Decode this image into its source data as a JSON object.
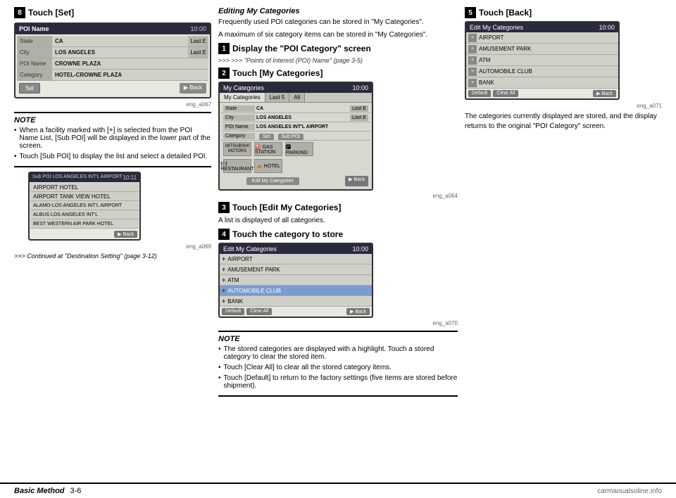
{
  "page": {
    "footer": {
      "left": "Basic Method",
      "page_num": "3-6",
      "watermark": "carmanualsoline.info"
    }
  },
  "left_col": {
    "section_title": "Touch [Set]",
    "step_num": "8",
    "screen1": {
      "title": "POI Name",
      "time": "10:00",
      "rows": [
        {
          "label": "State",
          "value": "CA",
          "extra": "Last E"
        },
        {
          "label": "City",
          "value": "LOS ANGELES",
          "extra": "Last E"
        },
        {
          "label": "POI Name",
          "value": "CROWNE PLAZA",
          "extra": ""
        },
        {
          "label": "Category",
          "value": "HOTEL-CROWNE PLAZA",
          "extra": ""
        }
      ],
      "buttons": [
        "Set",
        "Back"
      ],
      "img_label": "eng_a067"
    },
    "note": {
      "title": "NOTE",
      "items": [
        "When a facility marked with [+] is selected from the POI Name List, [Sub POI] will be displayed in the lower part of the screen.",
        "Touch [Sub POI] to display the list and select a detailed POI."
      ]
    },
    "screen2": {
      "title": "Sub POI: LOS ANGELES INT'L AIRPORT",
      "time": "10:11",
      "rows": [
        "AIRPORT HOTEL",
        "AIRPORT TANK VIEW HOTEL",
        "ALAMO-LOS ANGELES INT'L AIRPORT",
        "ALBUS LOS ANGELES INT'L",
        "BEST WESTERN AIR PARK HOTEL"
      ],
      "img_label": "eng_a069"
    },
    "continued_text": ">>> Continued at \"Destination Setting\" (page 3-12)"
  },
  "mid_col": {
    "italic_title": "Editing My Categories",
    "description1": "Frequently used POI categories can be stored in \"My Categories\".",
    "description2": "A maximum of six category items can be stored in \"My Categories\".",
    "steps": [
      {
        "num": "1",
        "title": "Display the \"POI Category\" screen",
        "arrow_text": ">>> \"Points of Interest (POI) Name\" (page 3-5)"
      },
      {
        "num": "2",
        "title": "Touch [My Categories]",
        "screen": {
          "title": "My Categories",
          "time": "10:00",
          "tabs": [
            "My Categories",
            "Last 5",
            "All"
          ],
          "poi_row_label": "POI Name",
          "poi_row_value": "LOS ANGELES INT'L AIRPORT",
          "poi_cat_label": "Category",
          "poi_cat_value": "Set",
          "sub_poi_btn": "Sub POI",
          "icons": [
            {
              "icon": "MITSUBISHI MOTORS",
              "label": ""
            },
            {
              "icon": "GAS STATION",
              "label": ""
            },
            {
              "icon": "PARKING",
              "label": ""
            },
            {
              "icon": "RESTAURANT",
              "label": ""
            },
            {
              "icon": "HOTEL",
              "label": ""
            }
          ],
          "bottom_btn": "Edit My Categories",
          "back_btn": "Back",
          "img_label": "eng_a064"
        }
      },
      {
        "num": "3",
        "title": "Touch [Edit My Categories]",
        "body_text": "A list is displayed of all categories."
      },
      {
        "num": "4",
        "title": "Touch the category to store",
        "screen": {
          "title": "Edit My Categories",
          "time": "10:00",
          "rows": [
            {
              "icon": "+",
              "label": "AIRPORT",
              "selected": false
            },
            {
              "icon": "+",
              "label": "AMUSEMENT PARK",
              "selected": false
            },
            {
              "icon": "+",
              "label": "ATM",
              "selected": false
            },
            {
              "icon": "+",
              "label": "AUTOMOBILE CLUB",
              "selected": true
            },
            {
              "icon": "+",
              "label": "BANK",
              "selected": false
            }
          ],
          "buttons": [
            "Default",
            "Clear All"
          ],
          "back_btn": "Back",
          "img_label": "eng_a070"
        }
      }
    ],
    "note2": {
      "title": "NOTE",
      "items": [
        "The stored categories are displayed with a highlight. Touch a stored category to clear the stored item.",
        "Touch [Clear All] to clear all the stored category items.",
        "Touch [Default] to return to the factory settings (five items are stored before shipment)."
      ]
    }
  },
  "right_col": {
    "step": {
      "num": "5",
      "title": "Touch [Back]",
      "screen": {
        "title": "Edit My Categories",
        "time": "10:00",
        "rows": [
          {
            "icon": "+",
            "label": "AIRPORT",
            "selected": false
          },
          {
            "icon": "+",
            "label": "AMUSEMENT PARK",
            "selected": false
          },
          {
            "icon": "+",
            "label": "ATM",
            "selected": false
          },
          {
            "icon": "+",
            "label": "AUTOMOBILE CLUB",
            "selected": false
          },
          {
            "icon": "+",
            "label": "BANK",
            "selected": false
          }
        ],
        "buttons": [
          "Default",
          "Clear All"
        ],
        "back_btn": "Back",
        "img_label": "eng_a071"
      }
    },
    "conclusion_text": "The categories currently displayed are stored, and the display returns to the original \"POI Category\" screen."
  }
}
